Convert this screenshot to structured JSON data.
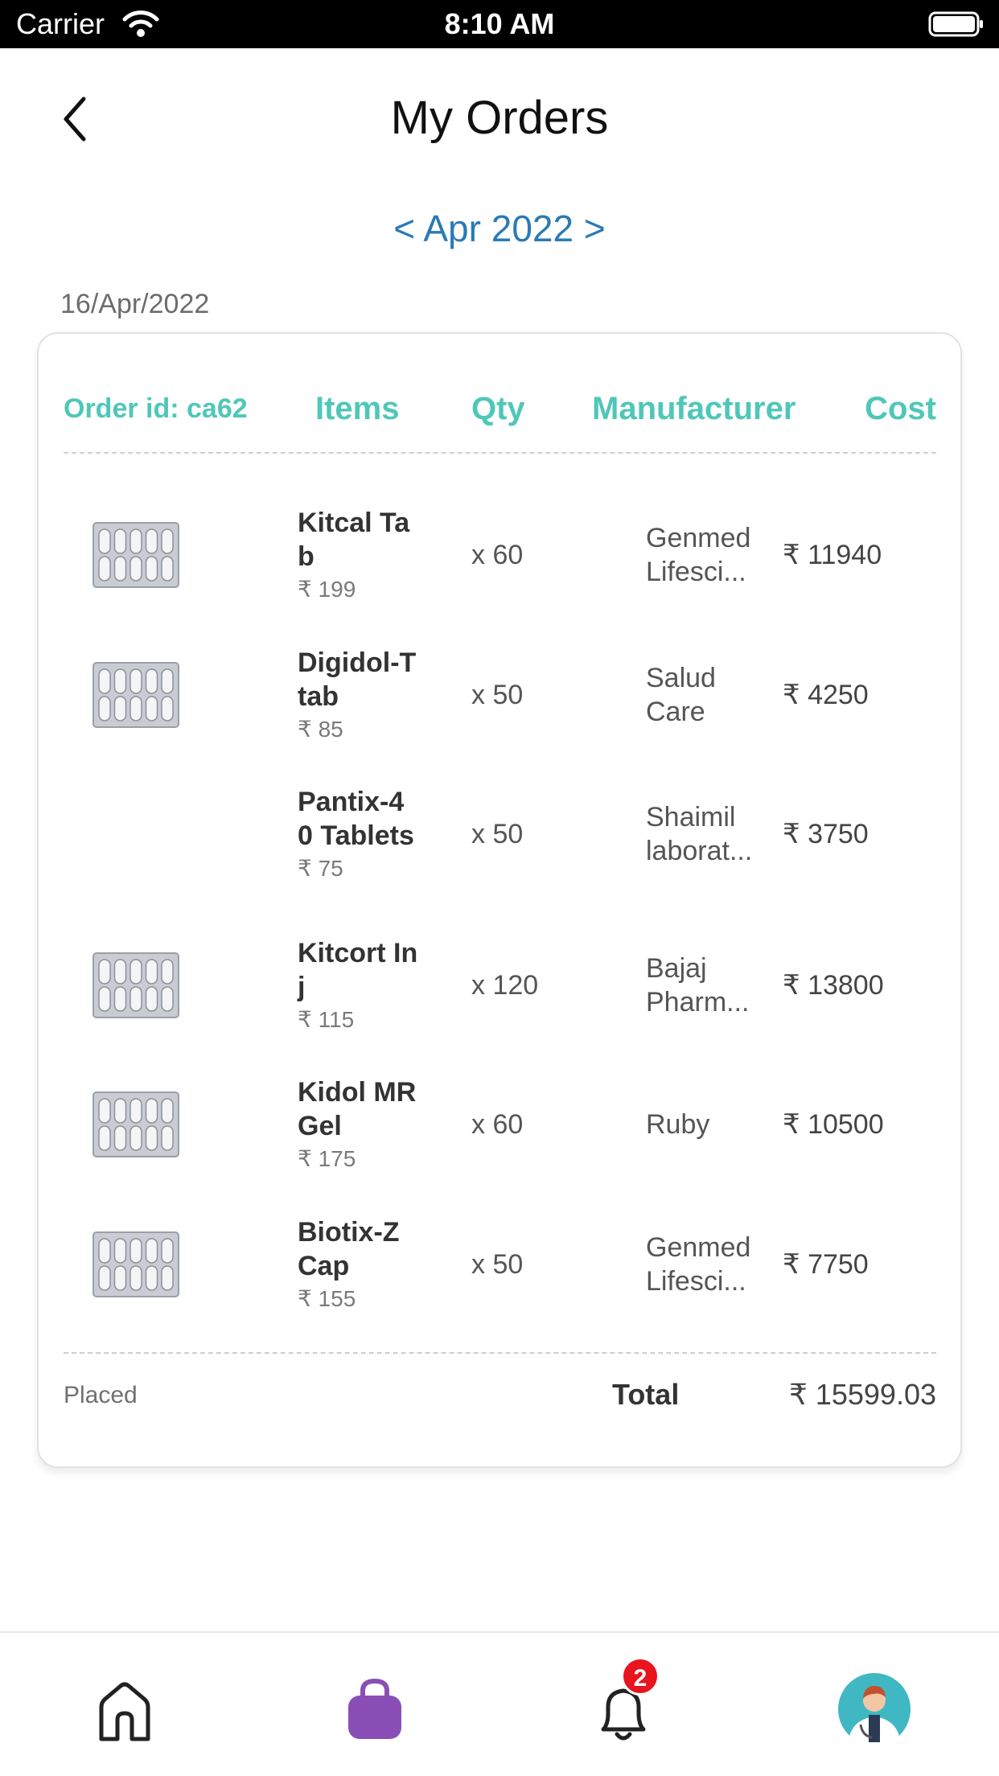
{
  "status_bar": {
    "carrier": "Carrier",
    "time": "8:10 AM"
  },
  "header": {
    "title": "My Orders"
  },
  "month_nav": {
    "prev": "<",
    "label": "Apr 2022",
    "next": ">"
  },
  "order": {
    "date": "16/Apr/2022",
    "id_label": "Order id: ca62",
    "columns": {
      "items": "Items",
      "qty": "Qty",
      "manufacturer": "Manufacturer",
      "cost": "Cost"
    },
    "items": [
      {
        "name": "Kitcal Tab",
        "price": "₹ 199",
        "qty": "x 60",
        "manufacturer_l1": "Genmed",
        "manufacturer_l2": "Lifesci...",
        "cost": "₹ 11940",
        "has_image": true
      },
      {
        "name": "Digidol-T tab",
        "price": "₹ 85",
        "qty": "x 50",
        "manufacturer_l1": "Salud",
        "manufacturer_l2": "Care",
        "cost": "₹ 4250",
        "has_image": true
      },
      {
        "name": "Pantix-40 Tablets",
        "price": "₹ 75",
        "qty": "x 50",
        "manufacturer_l1": "Shaimil",
        "manufacturer_l2": "laborat...",
        "cost": "₹ 3750",
        "has_image": false
      },
      {
        "name": "Kitcort Inj",
        "price": "₹ 115",
        "qty": "x 120",
        "manufacturer_l1": "Bajaj",
        "manufacturer_l2": "Pharm...",
        "cost": "₹ 13800",
        "has_image": true
      },
      {
        "name": "Kidol MR Gel",
        "price": "₹ 175",
        "qty": "x 60",
        "manufacturer_l1": "Ruby",
        "manufacturer_l2": "",
        "cost": "₹ 10500",
        "has_image": true
      },
      {
        "name": "Biotix-Z Cap",
        "price": "₹ 155",
        "qty": "x 50",
        "manufacturer_l1": "Genmed",
        "manufacturer_l2": "Lifesci...",
        "cost": "₹ 7750",
        "has_image": true
      }
    ],
    "status": "Placed",
    "total_label": "Total",
    "total_value": "₹ 15599.03"
  },
  "tab_bar": {
    "tabs": [
      {
        "icon": "home-icon"
      },
      {
        "icon": "shopping-bag-icon",
        "active": true
      },
      {
        "icon": "bell-icon",
        "badge": "2"
      },
      {
        "icon": "doctor-avatar-icon"
      }
    ]
  },
  "colors": {
    "accent_teal": "#4fc7b8",
    "link_blue": "#2a7ab6",
    "active_tab": "#8a4fb6",
    "badge_red": "#e8141e"
  }
}
